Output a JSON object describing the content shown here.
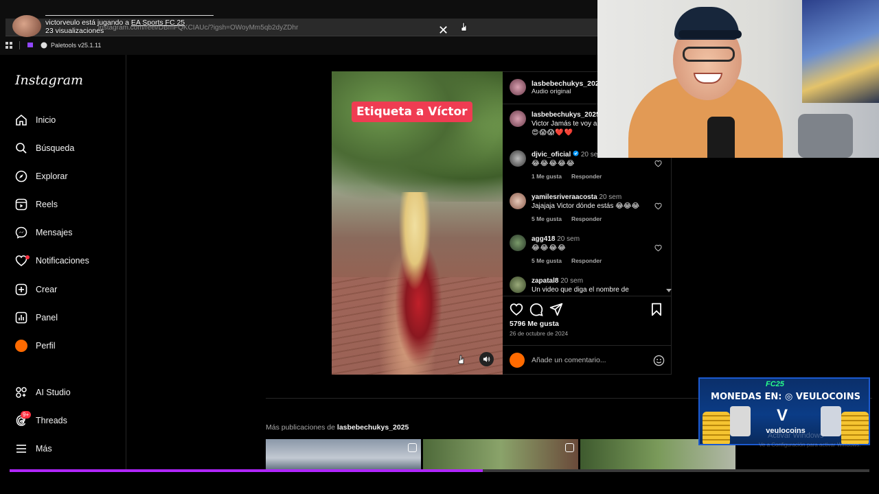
{
  "stream": {
    "status_prefix": "victorveulo está jugando a ",
    "game": "EA Sports FC 25",
    "views": "23 visualizaciones"
  },
  "browser": {
    "url": "instagram.com/reel/DBmFQKCIAUc/?igsh=OWoyMm5qb2dyZDhr",
    "bookmark": "Paletools v25.1.11"
  },
  "sidebar": {
    "logo": "Instagram",
    "items": [
      {
        "label": "Inicio",
        "icon": "home-icon"
      },
      {
        "label": "Búsqueda",
        "icon": "search-icon"
      },
      {
        "label": "Explorar",
        "icon": "compass-icon"
      },
      {
        "label": "Reels",
        "icon": "reels-icon"
      },
      {
        "label": "Mensajes",
        "icon": "messenger-icon"
      },
      {
        "label": "Notificaciones",
        "icon": "heart-icon"
      },
      {
        "label": "Crear",
        "icon": "plus-square-icon"
      },
      {
        "label": "Panel",
        "icon": "chart-icon"
      },
      {
        "label": "Perfil",
        "icon": "profile-avatar"
      },
      {
        "label": "AI Studio",
        "icon": "ai-studio-icon"
      },
      {
        "label": "Threads",
        "icon": "threads-icon",
        "badge": "9+"
      },
      {
        "label": "Más",
        "icon": "menu-icon"
      }
    ]
  },
  "post": {
    "overlay_text": "Etiqueta a Víctor",
    "author": "lasbebechukys_2025",
    "audio": "Audio original",
    "caption_user": "lasbebechukys_2025",
    "caption_text": "Victor Jamás te voy a",
    "caption_emojis": "😍😱😱❤️❤️",
    "comments": [
      {
        "user": "djvic_oficial",
        "verified": true,
        "time": "20 sem",
        "text": "😂😂😂😂😂",
        "likes": "1 Me gusta",
        "reply": "Responder"
      },
      {
        "user": "yamilesriveraacosta",
        "time": "20 sem",
        "text": "Jajajaja Victor dónde estás 😂😂😂",
        "likes": "5 Me gusta",
        "reply": "Responder"
      },
      {
        "user": "agg418",
        "time": "20 sem",
        "text": "😂😂😂😂",
        "likes": "5 Me gusta",
        "reply": "Responder"
      },
      {
        "user": "zapatal8",
        "time": "20 sem",
        "text": "Un video que diga el nombre de",
        "likes": "",
        "reply": ""
      }
    ],
    "like_count": "5796 Me gusta",
    "date": "26 de octubre de 2024",
    "comment_placeholder": "Añade un comentario..."
  },
  "more_posts": {
    "prefix": "Más publicaciones de ",
    "user": "lasbebechukys_2025"
  },
  "progress": {
    "value_percent": 55
  },
  "promo": {
    "game_logo": "FC25",
    "title": "MONEDAS EN: ◎ VEULOCOINS",
    "brand": "veulocoins"
  },
  "watermark": {
    "line1": "Activar Windows",
    "line2": "Ve a Configuración para activar Windows."
  },
  "colors": {
    "accent_purple": "#b026ff",
    "notification_red": "#ff3040",
    "overlay_pink": "#ef3c52",
    "profile_orange": "#ff6a00"
  }
}
